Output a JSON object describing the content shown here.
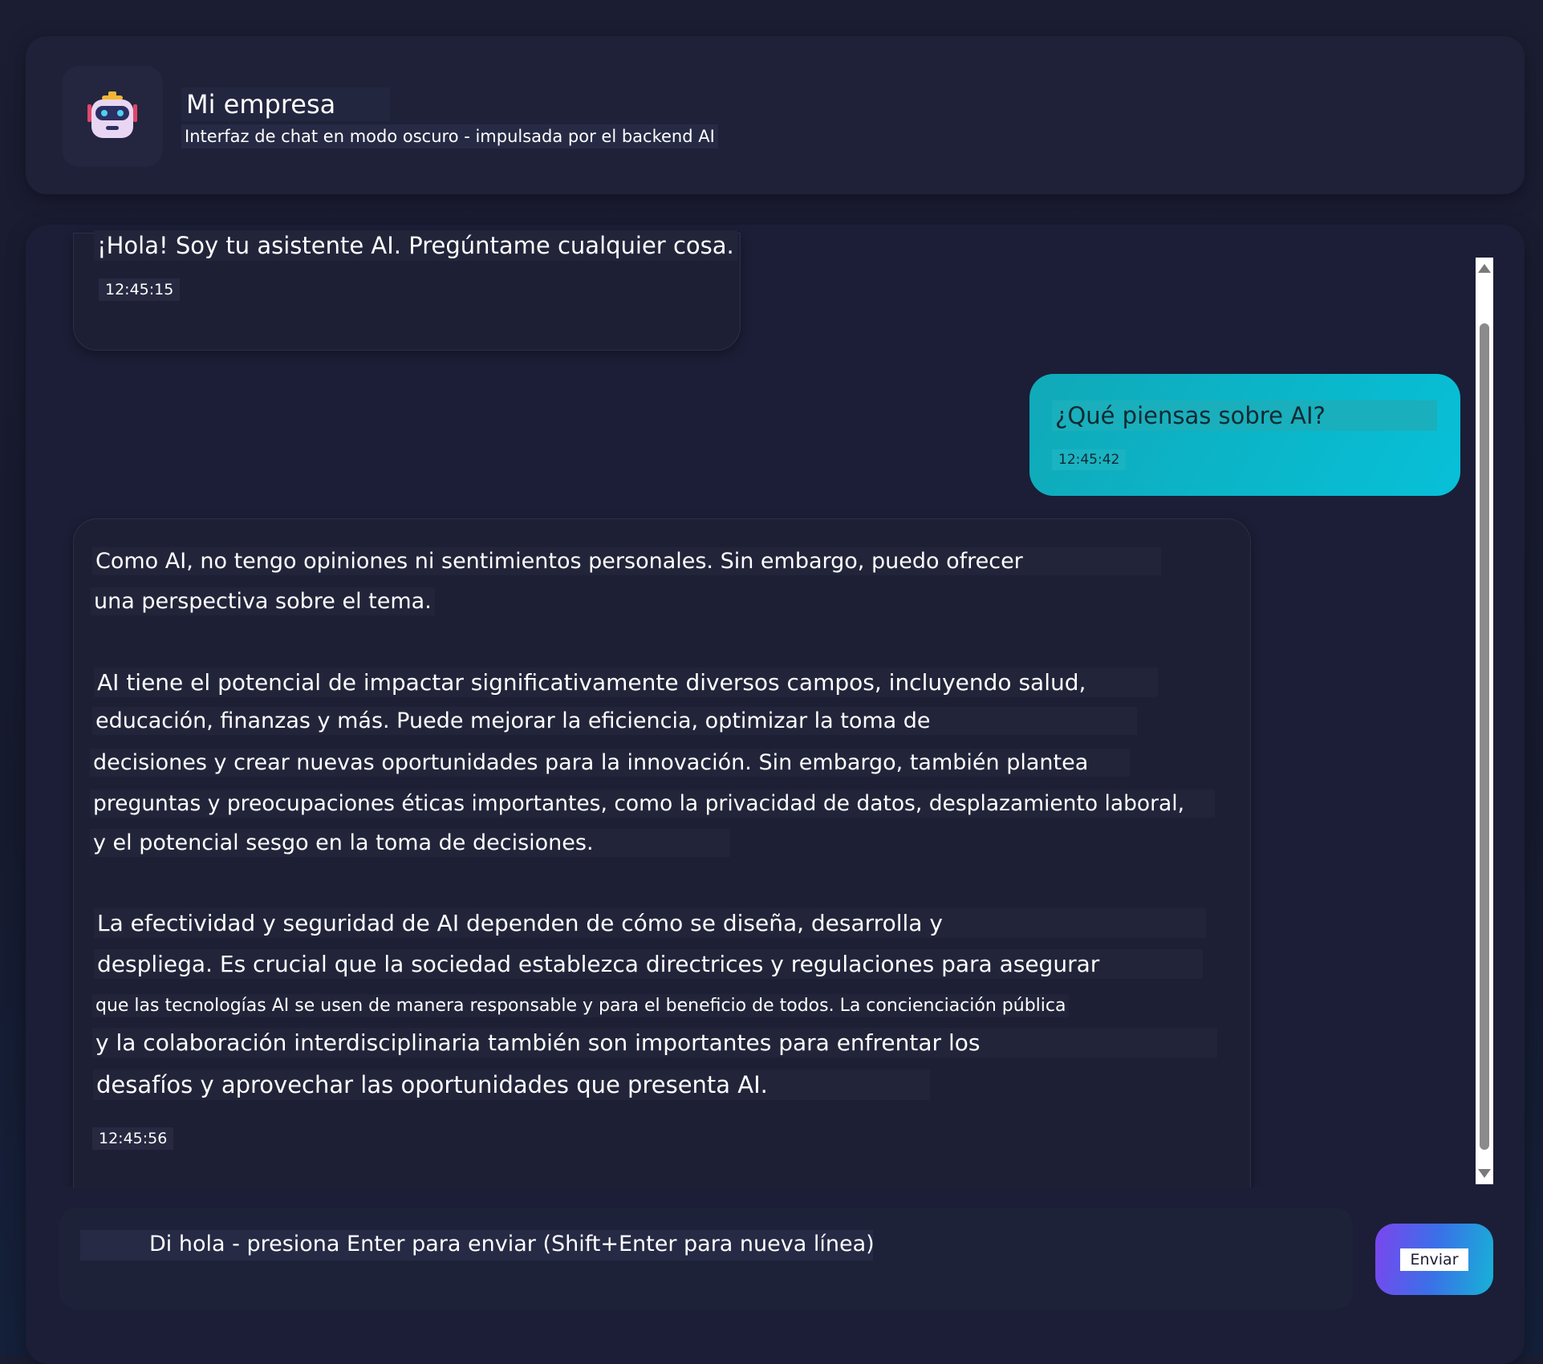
{
  "header": {
    "title": "Mi empresa",
    "subtitle": "Interfaz de chat en modo oscuro - impulsada por el backend AI",
    "avatar_icon": "robot-icon"
  },
  "messages": [
    {
      "role": "assistant",
      "lines": [
        "¡Hola! Soy tu asistente AI. Pregúntame cualquier cosa."
      ],
      "time": "12:45:15"
    },
    {
      "role": "user",
      "lines": [
        "¿Qué piensas sobre AI?"
      ],
      "time": "12:45:42"
    },
    {
      "role": "assistant",
      "lines": [
        "Como AI, no tengo opiniones ni sentimientos personales. Sin embargo, puedo ofrecer",
        "una perspectiva sobre el tema.",
        "AI tiene el potencial de impactar significativamente diversos campos, incluyendo salud,",
        "educación, finanzas y más. Puede mejorar la eficiencia, optimizar la toma de",
        "decisiones y crear nuevas oportunidades para la innovación. Sin embargo, también plantea",
        "preguntas y preocupaciones éticas importantes, como la privacidad de datos, desplazamiento laboral,",
        "y el potencial sesgo en la toma de decisiones.",
        "La efectividad y seguridad de AI dependen de cómo se diseña, desarrolla y",
        "despliega. Es crucial que la sociedad establezca directrices y regulaciones para asegurar",
        "que las tecnologías AI se usen de manera responsable y para el beneficio de todos. La concienciación pública",
        "y la colaboración interdisciplinaria también son importantes para enfrentar los",
        "desafíos y aprovechar las oportunidades que presenta AI."
      ],
      "time": "12:45:56"
    }
  ],
  "composer": {
    "placeholder": "Di hola - presiona Enter para enviar (Shift+Enter para nueva línea)",
    "send_label": "Enviar"
  },
  "colors": {
    "background": "#1b1d33",
    "panel": "#1f2138",
    "user_bubble": "#07c0d8",
    "send_gradient_start": "#7c45ee",
    "send_gradient_end": "#17b3d6"
  }
}
